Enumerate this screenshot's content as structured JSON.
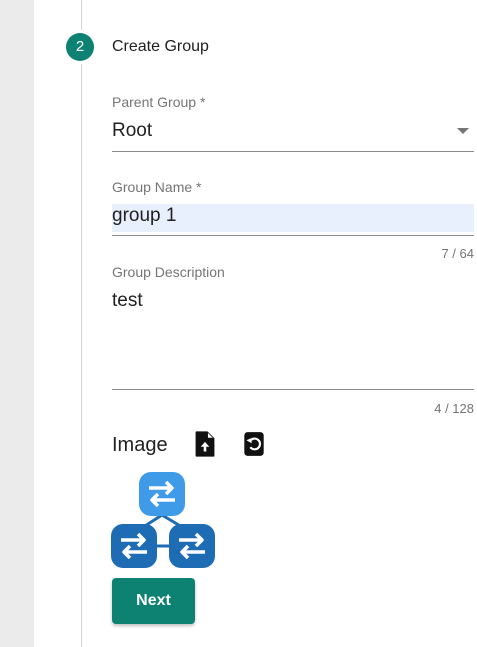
{
  "stepper": {
    "step_number": "2",
    "step_title": "Create Group"
  },
  "form": {
    "parent_group": {
      "label": "Parent Group *",
      "value": "Root"
    },
    "group_name": {
      "label": "Group Name *",
      "value": "group 1",
      "counter": "7 / 64"
    },
    "group_description": {
      "label": "Group Description",
      "value": "test",
      "counter": "4 / 128"
    },
    "image": {
      "label": "Image",
      "upload_icon": "file-upload-icon",
      "reset_icon": "restore-icon"
    }
  },
  "actions": {
    "next_label": "Next"
  },
  "colors": {
    "accent": "#0d8272",
    "autofill_bg": "#e8f0fe",
    "group_icon_light": "#3f9be8",
    "group_icon_dark": "#1e6cb3"
  }
}
